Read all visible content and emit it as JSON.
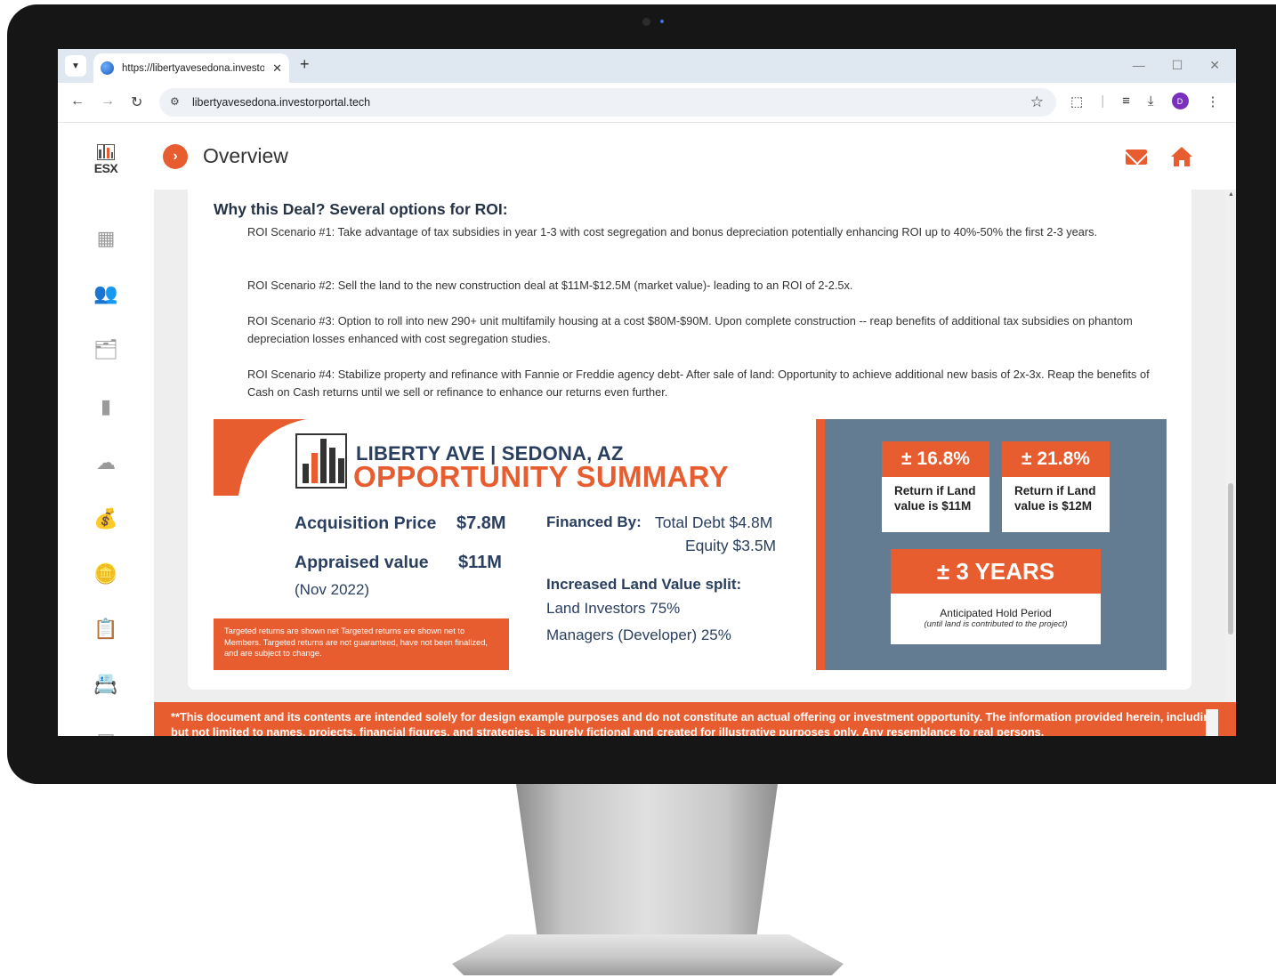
{
  "browser": {
    "tab_title": "https://libertyavesedona.investo",
    "url": "libertyavesedona.investorportal.tech",
    "profile_initial": "D"
  },
  "app": {
    "logo_text": "ESX",
    "page_title": "Overview"
  },
  "content": {
    "heading": "Why this Deal? Several options for ROI:",
    "scenarios": [
      "ROI Scenario #1: Take advantage of tax subsidies in year 1-3 with cost segregation and bonus depreciation potentially enhancing ROI up to 40%-50% the first 2-3 years.",
      "ROI Scenario #2: Sell the land to the new construction deal at $11M-$12.5M (market value)- leading to an ROI of 2-2.5x.",
      "ROI Scenario #3: Option to roll into new 290+ unit multifamily housing at a cost $80M-$90M. Upon complete construction -- reap benefits of additional tax subsidies on phantom depreciation losses enhanced with cost segregation studies.",
      "ROI Scenario #4: Stabilize property and refinance with Fannie or Freddie agency debt- After sale of land: Opportunity to achieve additional new basis of 2x-3x. Reap the benefits of Cash on Cash returns until we sell or refinance to enhance our returns even further."
    ]
  },
  "summary": {
    "title_line1": "LIBERTY AVE | SEDONA, AZ",
    "title_line2": "OPPORTUNITY SUMMARY",
    "acquisition_label": "Acquisition Price",
    "acquisition_value": "$7.8M",
    "appraised_label": "Appraised value",
    "appraised_value": "$11M",
    "appraised_date": "(Nov 2022)",
    "financed_label": "Financed By:",
    "financed_debt": "Total Debt $4.8M",
    "financed_equity": "Equity $3.5M",
    "split_label": "Increased Land Value split:",
    "split_investors": "Land Investors 75%",
    "split_managers": "Managers (Developer) 25%",
    "disclaimer": "Targeted returns are shown net Targeted returns are shown net to Members. Targeted returns are not guaranteed, have not been finalized, and are subject to change.",
    "stat1_value": "± 16.8%",
    "stat1_label": "Return if Land value is $11M",
    "stat2_value": "± 21.8%",
    "stat2_label": "Return if Land value is $12M",
    "stat3_value": "± 3 YEARS",
    "stat3_label": "Anticipated Hold Period",
    "stat3_sub": "(until land is contributed to the project)"
  },
  "footer": {
    "text": "**This document and its contents are intended solely for design example purposes and do not constitute an actual offering or investment opportunity. The information provided herein, including but not limited to names, projects, financial figures, and strategies, is purely fictional and created for illustrative purposes only. Any resemblance to real persons,"
  },
  "colors": {
    "accent": "#e85d2f",
    "navy": "#2a3f5f",
    "panel": "#637c92"
  }
}
